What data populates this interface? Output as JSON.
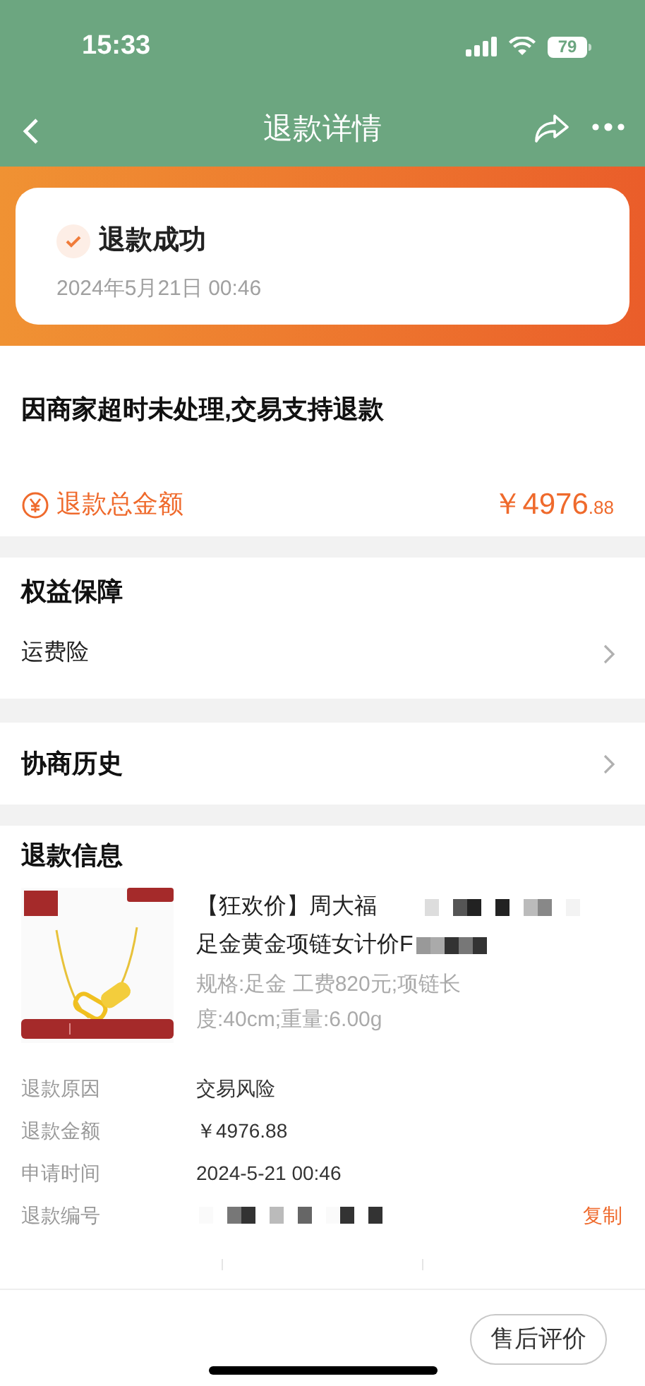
{
  "status_bar": {
    "time": "15:33",
    "battery": "79"
  },
  "nav": {
    "title": "退款详情"
  },
  "status_card": {
    "title": "退款成功",
    "time": "2024年5月21日 00:46",
    "done": true
  },
  "reason_section": {
    "message": "因商家超时未处理,交易支持退款",
    "amount_label": "退款总金额",
    "amount_main": "￥4976",
    "amount_cents": ".88"
  },
  "benefits": {
    "title": "权益保障",
    "items": [
      {
        "label": "运费险"
      }
    ]
  },
  "history": {
    "title": "协商历史"
  },
  "refund_info": {
    "title": "退款信息",
    "product": {
      "title_line1": "【狂欢价】周大福",
      "title_line2": "足金黄金项链女计价F",
      "spec": "规格:足金 工费820元;项链长度:40cm;重量:6.00g"
    },
    "rows": [
      {
        "label": "退款原因",
        "value": "交易风险"
      },
      {
        "label": "退款金额",
        "value": "￥4976.88"
      },
      {
        "label": "申请时间",
        "value": "2024-5-21 00:46"
      },
      {
        "label": "退款编号",
        "value_redacted": true,
        "action": "复制"
      }
    ]
  },
  "bottom_bar": {
    "button": "售后评价"
  }
}
